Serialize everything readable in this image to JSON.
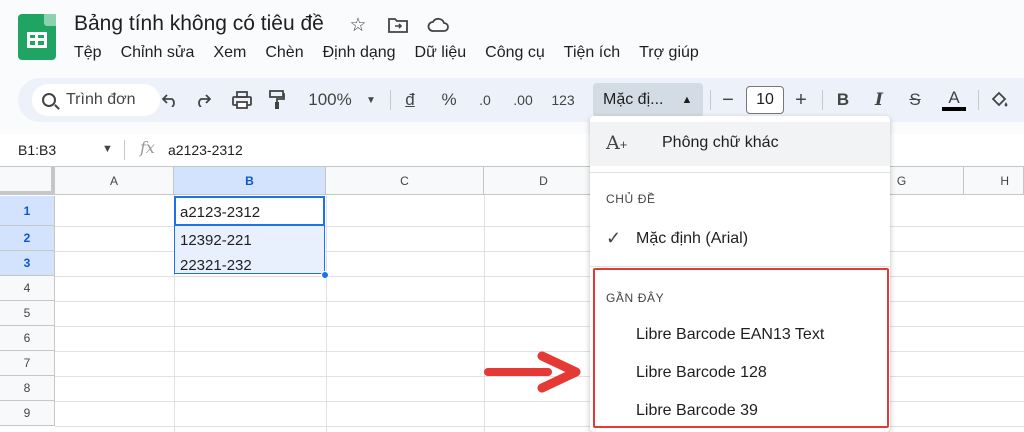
{
  "app": {
    "title": "Bảng tính không có tiêu đề",
    "icons": [
      "star-icon",
      "folder-move-icon",
      "cloud-status-icon"
    ]
  },
  "menubar": [
    "Tệp",
    "Chỉnh sửa",
    "Xem",
    "Chèn",
    "Định dạng",
    "Dữ liệu",
    "Công cụ",
    "Tiện ích",
    "Trợ giúp"
  ],
  "toolbar": {
    "search_placeholder": "Trình đơn",
    "zoom": "100%",
    "currency": "đ",
    "percent": "%",
    "decrease_decimal": ".0",
    "increase_decimal": ".00",
    "number_format": "123",
    "font": "Mặc đị...",
    "font_size": "10",
    "minus": "−",
    "plus": "+",
    "bold": "B",
    "italic": "I",
    "strikethrough": "S",
    "text_color": "A"
  },
  "formula_bar": {
    "namebox": "B1:B3",
    "fx": "fx",
    "value": "a2123-2312"
  },
  "grid": {
    "columns": [
      "A",
      "B",
      "C",
      "D",
      "G",
      "H"
    ],
    "rows": [
      "1",
      "2",
      "3",
      "4",
      "5",
      "6",
      "7",
      "8",
      "9"
    ],
    "cells": {
      "B1": "a2123-2312",
      "B2": "12392-221",
      "B3": "22321-232"
    }
  },
  "font_menu": {
    "more_fonts": "Phông chữ khác",
    "theme_header": "CHỦ ĐỀ",
    "default_font": "Mặc định (Arial)",
    "recent_header": "GẦN ĐÂY",
    "recent": [
      "Libre Barcode EAN13 Text",
      "Libre Barcode 128",
      "Libre Barcode 39"
    ]
  },
  "colors": {
    "accent": "#1a73e8",
    "annotation": "#e53935",
    "sheets_green": "#1fa463"
  }
}
